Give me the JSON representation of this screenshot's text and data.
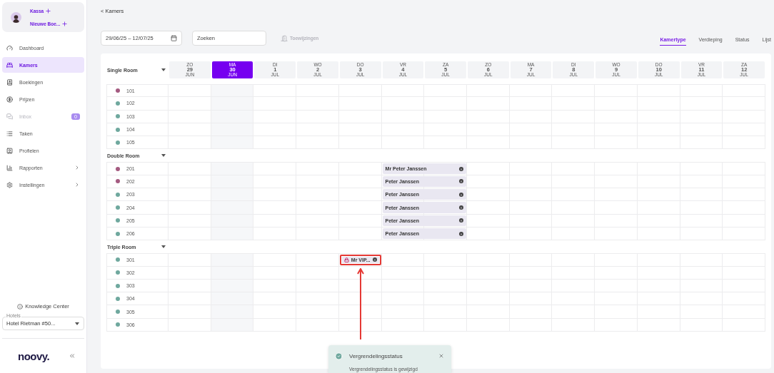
{
  "sidebar": {
    "quick_actions": [
      {
        "label": "Kassa"
      },
      {
        "label": "Nieuwe Boe..."
      }
    ],
    "items": [
      {
        "label": "Dashboard",
        "selected": false,
        "disabled": false,
        "submenu": false
      },
      {
        "label": "Kamers",
        "selected": true,
        "disabled": false,
        "submenu": false
      },
      {
        "label": "Boekingen",
        "selected": false,
        "disabled": false,
        "submenu": false
      },
      {
        "label": "Prijzen",
        "selected": false,
        "disabled": false,
        "submenu": false
      },
      {
        "label": "Inbox",
        "selected": false,
        "disabled": true,
        "submenu": false,
        "badge": "0"
      },
      {
        "label": "Taken",
        "selected": false,
        "disabled": false,
        "submenu": false
      },
      {
        "label": "Profielen",
        "selected": false,
        "disabled": false,
        "submenu": false
      },
      {
        "label": "Rapporten",
        "selected": false,
        "disabled": false,
        "submenu": true
      },
      {
        "label": "Instellingen",
        "selected": false,
        "disabled": false,
        "submenu": true
      }
    ],
    "knowledge_center": "Knowledge Center",
    "hotel_select": {
      "label": "Hotels",
      "value": "Hotel Rietman #50..."
    },
    "logo": "noovy."
  },
  "breadcrumb": "< Kamers",
  "toolbar": {
    "date_range": "29/06/25 – 12/07/25",
    "search": {
      "placeholder": "Zoeken"
    },
    "assign_button": {
      "label": "Toewijzingen",
      "disabled": true
    }
  },
  "view_tabs": [
    {
      "label": "Kamertype",
      "selected": true
    },
    {
      "label": "Verdieping",
      "selected": false
    },
    {
      "label": "Status",
      "selected": false
    },
    {
      "label": "Lijst",
      "selected": false
    }
  ],
  "days": [
    {
      "weekday": "ZO",
      "day": "29",
      "month": "JUN",
      "selected": false
    },
    {
      "weekday": "MA",
      "day": "30",
      "month": "JUN",
      "selected": true
    },
    {
      "weekday": "DI",
      "day": "1",
      "month": "JUL",
      "selected": false
    },
    {
      "weekday": "WO",
      "day": "2",
      "month": "JUL",
      "selected": false
    },
    {
      "weekday": "DO",
      "day": "3",
      "month": "JUL",
      "selected": false
    },
    {
      "weekday": "VR",
      "day": "4",
      "month": "JUL",
      "selected": false
    },
    {
      "weekday": "ZA",
      "day": "5",
      "month": "JUL",
      "selected": false
    },
    {
      "weekday": "ZO",
      "day": "6",
      "month": "JUL",
      "selected": false
    },
    {
      "weekday": "MA",
      "day": "7",
      "month": "JUL",
      "selected": false
    },
    {
      "weekday": "DI",
      "day": "8",
      "month": "JUL",
      "selected": false
    },
    {
      "weekday": "WO",
      "day": "9",
      "month": "JUL",
      "selected": false
    },
    {
      "weekday": "DO",
      "day": "10",
      "month": "JUL",
      "selected": false
    },
    {
      "weekday": "VR",
      "day": "11",
      "month": "JUL",
      "selected": false
    },
    {
      "weekday": "ZA",
      "day": "12",
      "month": "JUL",
      "selected": false
    }
  ],
  "groups": [
    {
      "name": "Single Room",
      "rooms": [
        {
          "number": "101",
          "color": "#a45a80"
        },
        {
          "number": "102",
          "color": "#6fa89e"
        },
        {
          "number": "103",
          "color": "#6fa89e"
        },
        {
          "number": "104",
          "color": "#6fa89e"
        },
        {
          "number": "105",
          "color": "#6fa89e"
        }
      ]
    },
    {
      "name": "Double Room",
      "rooms": [
        {
          "number": "201",
          "color": "#a45a80",
          "bookings": [
            {
              "guest": "Mr Peter Janssen",
              "locked": false,
              "highlighted": false
            }
          ]
        },
        {
          "number": "202",
          "color": "#a45a80",
          "bookings": [
            {
              "guest": "Peter Janssen",
              "locked": false,
              "highlighted": false
            }
          ]
        },
        {
          "number": "203",
          "color": "#6fa89e",
          "bookings": [
            {
              "guest": "Peter Janssen",
              "locked": false,
              "highlighted": false
            }
          ]
        },
        {
          "number": "204",
          "color": "#6fa89e",
          "bookings": [
            {
              "guest": "Peter Janssen",
              "locked": false,
              "highlighted": false
            }
          ]
        },
        {
          "number": "205",
          "color": "#6fa89e",
          "bookings": [
            {
              "guest": "Peter Janssen",
              "locked": false,
              "highlighted": false
            }
          ]
        },
        {
          "number": "206",
          "color": "#6fa89e",
          "bookings": [
            {
              "guest": "Peter Janssen",
              "locked": false,
              "highlighted": false
            }
          ]
        }
      ]
    },
    {
      "name": "Triple Room",
      "rooms": [
        {
          "number": "301",
          "color": "#6fa89e",
          "bookings": [
            {
              "guest": "Mr VIP...",
              "locked": true,
              "highlighted": true
            }
          ]
        },
        {
          "number": "302",
          "color": "#6fa89e"
        },
        {
          "number": "303",
          "color": "#6fa89e"
        },
        {
          "number": "304",
          "color": "#6fa89e"
        },
        {
          "number": "305",
          "color": "#6fa89e"
        },
        {
          "number": "306",
          "color": "#6fa89e"
        }
      ]
    }
  ],
  "toast": {
    "title": "Vergrendelingsstatus",
    "message": "Vergrendelingsstatus is gewijzigd"
  }
}
